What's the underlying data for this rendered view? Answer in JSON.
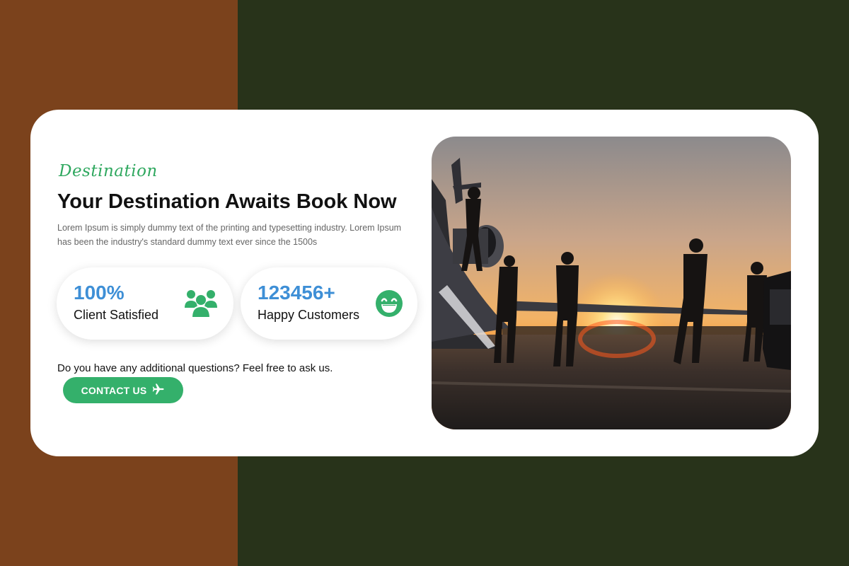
{
  "hero": {
    "tagline": "Destination",
    "title": "Your Destination Awaits Book Now",
    "description": "Lorem Ipsum is simply dummy text of the printing and typesetting industry. Lorem Ipsum has been the industry's standard dummy text ever since the 1500s"
  },
  "stats": [
    {
      "value": "100%",
      "label": "Client Satisfied",
      "icon": "users-group-icon"
    },
    {
      "value": "123456+",
      "label": "Happy Customers",
      "icon": "laughing-face-icon"
    }
  ],
  "cta": {
    "question": "Do you have any additional questions? Feel free to ask us.",
    "button_label": "CONTACT US",
    "button_icon": "airplane-icon"
  },
  "image": {
    "subject": "travel-sunset-photo"
  },
  "colors": {
    "accent_green": "#34b06b",
    "stat_blue": "#3e8fd6",
    "bg_left": "#7b421c",
    "bg_right": "#28331a"
  }
}
